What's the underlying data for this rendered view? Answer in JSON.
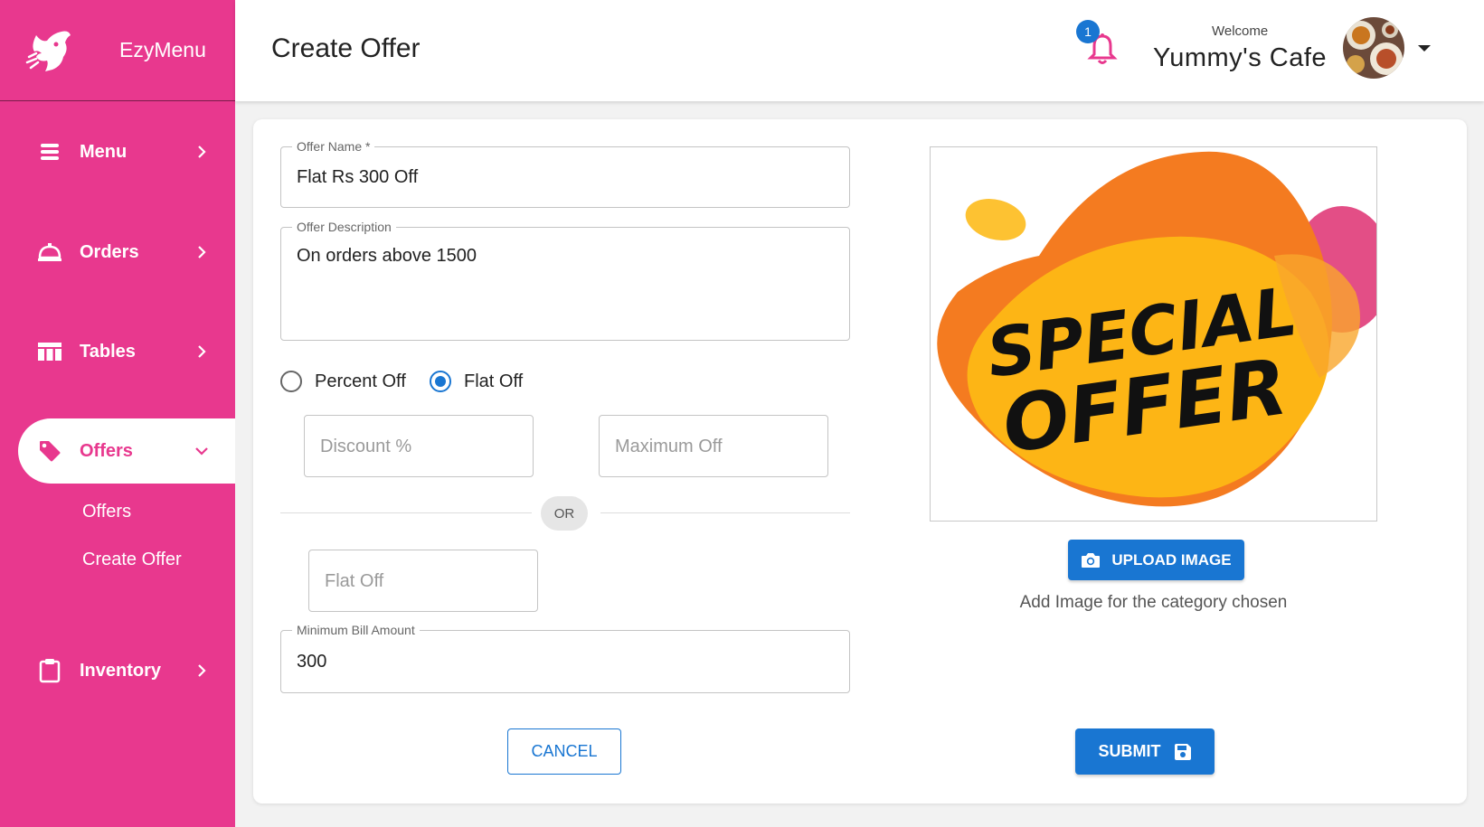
{
  "brand": {
    "name": "EzyMenu"
  },
  "sidebar": {
    "items": [
      {
        "label": "Menu",
        "icon": "menu-lines-icon"
      },
      {
        "label": "Orders",
        "icon": "cloche-icon"
      },
      {
        "label": "Tables",
        "icon": "table-icon"
      },
      {
        "label": "Offers",
        "icon": "tag-icon"
      },
      {
        "label": "Inventory",
        "icon": "clipboard-icon"
      }
    ],
    "subitems": [
      {
        "label": "Offers"
      },
      {
        "label": "Create Offer"
      }
    ]
  },
  "header": {
    "title": "Create Offer",
    "notification_count": "1",
    "welcome": "Welcome",
    "cafe_name": "Yummy's Cafe"
  },
  "form": {
    "offer_name": {
      "label": "Offer Name *",
      "value": "Flat Rs 300 Off"
    },
    "offer_description": {
      "label": "Offer Description",
      "value": "On orders above 1500"
    },
    "radio": {
      "percent_off": "Percent Off",
      "flat_off": "Flat Off",
      "selected": "Flat Off"
    },
    "discount_placeholder": "Discount %",
    "maximum_off_placeholder": "Maximum Off",
    "or_label": "OR",
    "flat_off_placeholder": "Flat Off",
    "minimum_bill": {
      "label": "Minimum Bill Amount",
      "value": "300"
    }
  },
  "image_panel": {
    "image_text_line1": "SPECIAL",
    "image_text_line2": "OFFER",
    "upload_label": "UPLOAD IMAGE",
    "hint": "Add Image for the category chosen"
  },
  "actions": {
    "cancel": "CANCEL",
    "submit": "SUBMIT"
  },
  "colors": {
    "brand_pink": "#e8388e",
    "primary_blue": "#1976d2",
    "offer_orange": "#f47b20",
    "offer_yellow": "#fdb515"
  }
}
